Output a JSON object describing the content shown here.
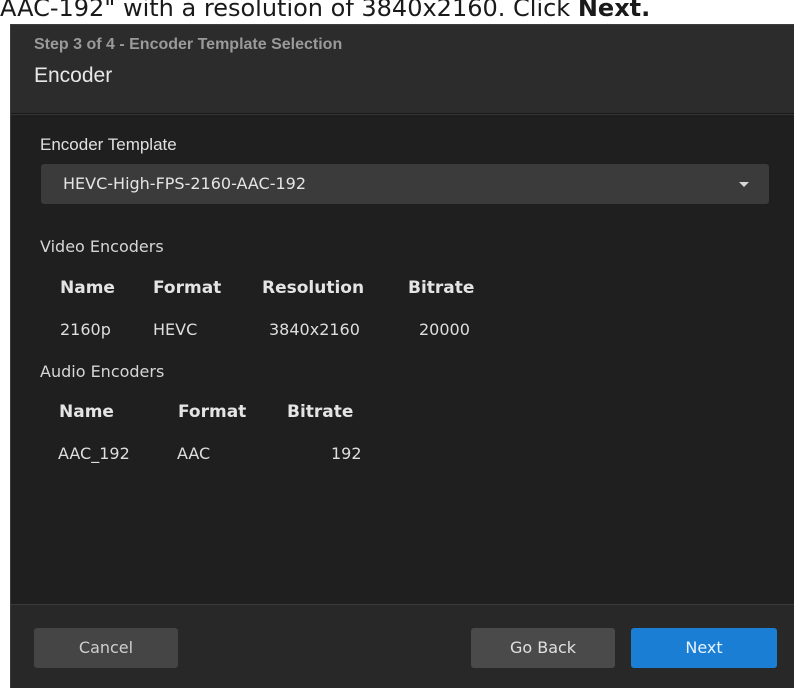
{
  "caption": {
    "prefix": "AAC-192\" with a resolution of 3840x2160. Click ",
    "emphasis": "Next."
  },
  "dialog": {
    "step_title": "Step 3 of 4 - Encoder Template Selection",
    "title": "Encoder",
    "encoder_template_label": "Encoder Template",
    "encoder_template_value": "HEVC-High-FPS-2160-AAC-192",
    "video": {
      "section_label": "Video Encoders",
      "headers": [
        "Name",
        "Format",
        "Resolution",
        "Bitrate"
      ],
      "rows": [
        [
          "2160p",
          "HEVC",
          "3840x2160",
          "20000"
        ]
      ]
    },
    "audio": {
      "section_label": "Audio Encoders",
      "headers": [
        "Name",
        "Format",
        "Bitrate"
      ],
      "rows": [
        [
          "AAC_192",
          "AAC",
          "192"
        ]
      ]
    },
    "footer": {
      "cancel_label": "Cancel",
      "back_label": "Go Back",
      "next_label": "Next"
    }
  },
  "colors": {
    "accent": "#1a7fd4",
    "background": "#1f1f1f"
  }
}
